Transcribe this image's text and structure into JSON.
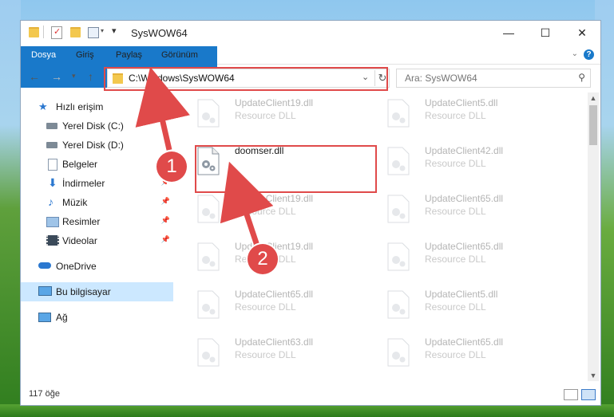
{
  "window": {
    "title": "SysWOW64",
    "controls": {
      "minimize": "—",
      "maximize": "☐",
      "close": "✕"
    }
  },
  "ribbon": {
    "tabs": [
      "Dosya",
      "Giriş",
      "Paylaş",
      "Görünüm"
    ],
    "help": "?"
  },
  "address": {
    "path": "C:\\Windows\\SysWOW64",
    "dropdown": "⌄",
    "refresh": "↻"
  },
  "search": {
    "placeholder": "Ara: SysWOW64"
  },
  "sidebar": {
    "items": [
      {
        "label": "Hızlı erişim",
        "icon": "star-icon"
      },
      {
        "label": "Yerel Disk (C:)",
        "icon": "drive-icon"
      },
      {
        "label": "Yerel Disk (D:)",
        "icon": "drive-icon"
      },
      {
        "label": "Belgeler",
        "icon": "documents-icon"
      },
      {
        "label": "İndirmeler",
        "icon": "download-icon"
      },
      {
        "label": "Müzik",
        "icon": "music-icon"
      },
      {
        "label": "Resimler",
        "icon": "pictures-icon"
      },
      {
        "label": "Videolar",
        "icon": "videos-icon"
      },
      {
        "label": "OneDrive",
        "icon": "cloud-icon"
      },
      {
        "label": "Bu bilgisayar",
        "icon": "computer-icon"
      },
      {
        "label": "Ağ",
        "icon": "network-icon"
      }
    ]
  },
  "files": {
    "left": [
      {
        "name": "UpdateClient19.dll",
        "type": "Resource DLL"
      },
      {
        "name": "doomser.dll",
        "type": ""
      },
      {
        "name": "UpdateClient19.dll",
        "type": "Resource DLL"
      },
      {
        "name": "UpdateClient19.dll",
        "type": "Resource DLL"
      },
      {
        "name": "UpdateClient65.dll",
        "type": "Resource DLL"
      },
      {
        "name": "UpdateClient63.dll",
        "type": "Resource DLL"
      }
    ],
    "right": [
      {
        "name": "UpdateClient5.dll",
        "type": "Resource DLL"
      },
      {
        "name": "UpdateClient42.dll",
        "type": "Resource DLL"
      },
      {
        "name": "UpdateClient65.dll",
        "type": "Resource DLL"
      },
      {
        "name": "UpdateClient65.dll",
        "type": "Resource DLL"
      },
      {
        "name": "UpdateClient5.dll",
        "type": "Resource DLL"
      },
      {
        "name": "UpdateClient65.dll",
        "type": "Resource DLL"
      }
    ]
  },
  "status": {
    "count": "117 öğe"
  },
  "annotations": {
    "step1": "1",
    "step2": "2",
    "color": "#e04a4a"
  }
}
